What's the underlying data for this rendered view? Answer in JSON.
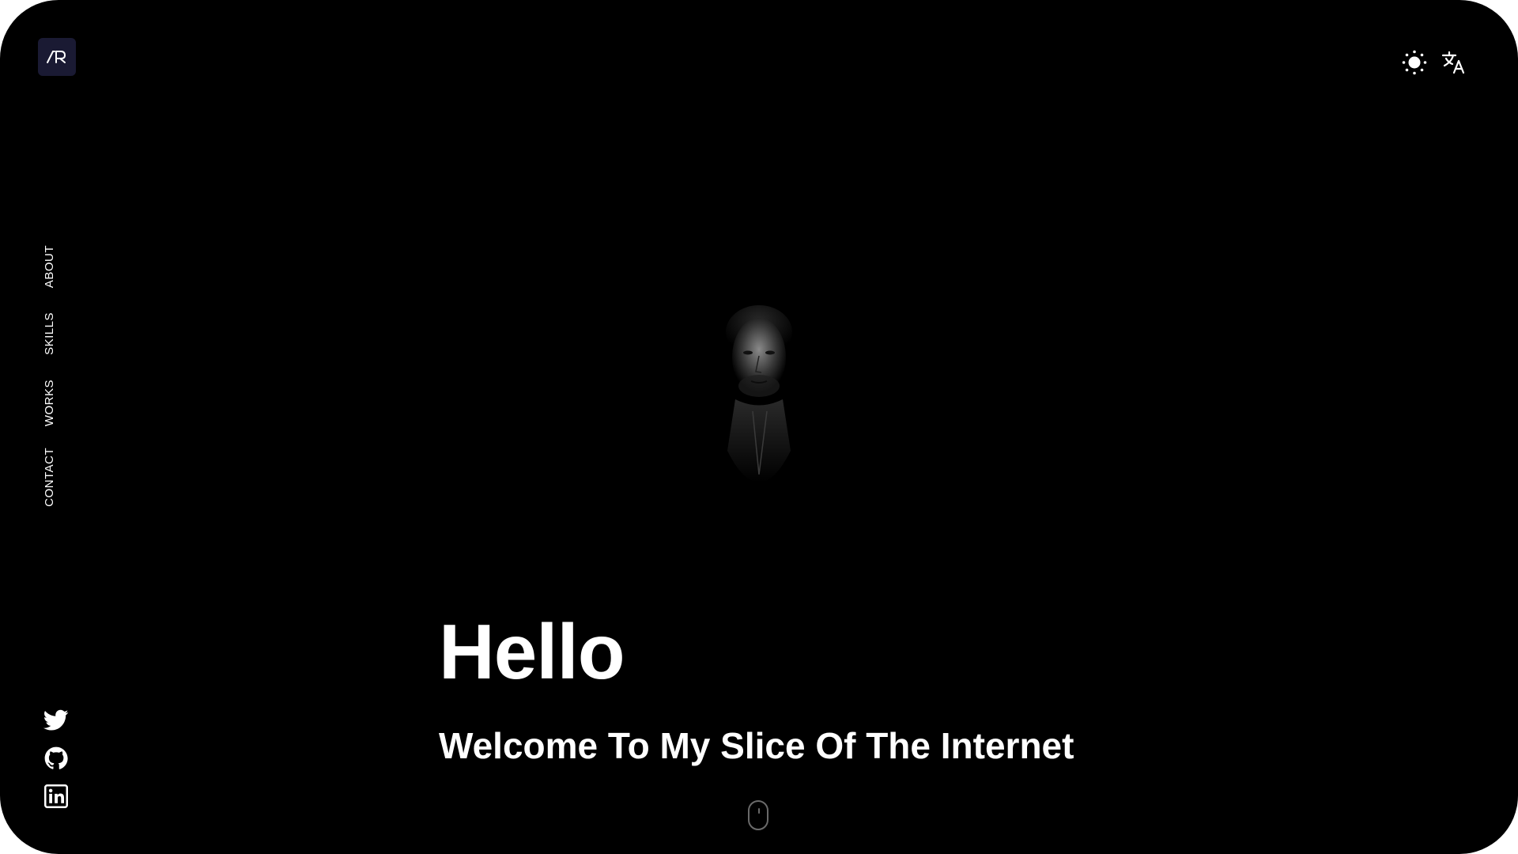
{
  "logo": {
    "text": "AR",
    "bg_color": "#1a1a33"
  },
  "header": {
    "theme_toggle_icon": "sun-icon",
    "language_icon": "translate-icon"
  },
  "nav": {
    "items": [
      {
        "label": "ABOUT"
      },
      {
        "label": "SKILLS"
      },
      {
        "label": "WORKS"
      },
      {
        "label": "CONTACT"
      }
    ]
  },
  "social": {
    "items": [
      {
        "icon": "twitter-icon"
      },
      {
        "icon": "github-icon"
      },
      {
        "icon": "linkedin-icon"
      }
    ]
  },
  "hero": {
    "greeting": "Hello",
    "subtitle": "Welcome To My Slice Of The Internet",
    "scroll_indicator_icon": "mouse-scroll-icon"
  },
  "colors": {
    "background": "#000000",
    "text": "#ffffff",
    "accent": "#1a1a33"
  }
}
